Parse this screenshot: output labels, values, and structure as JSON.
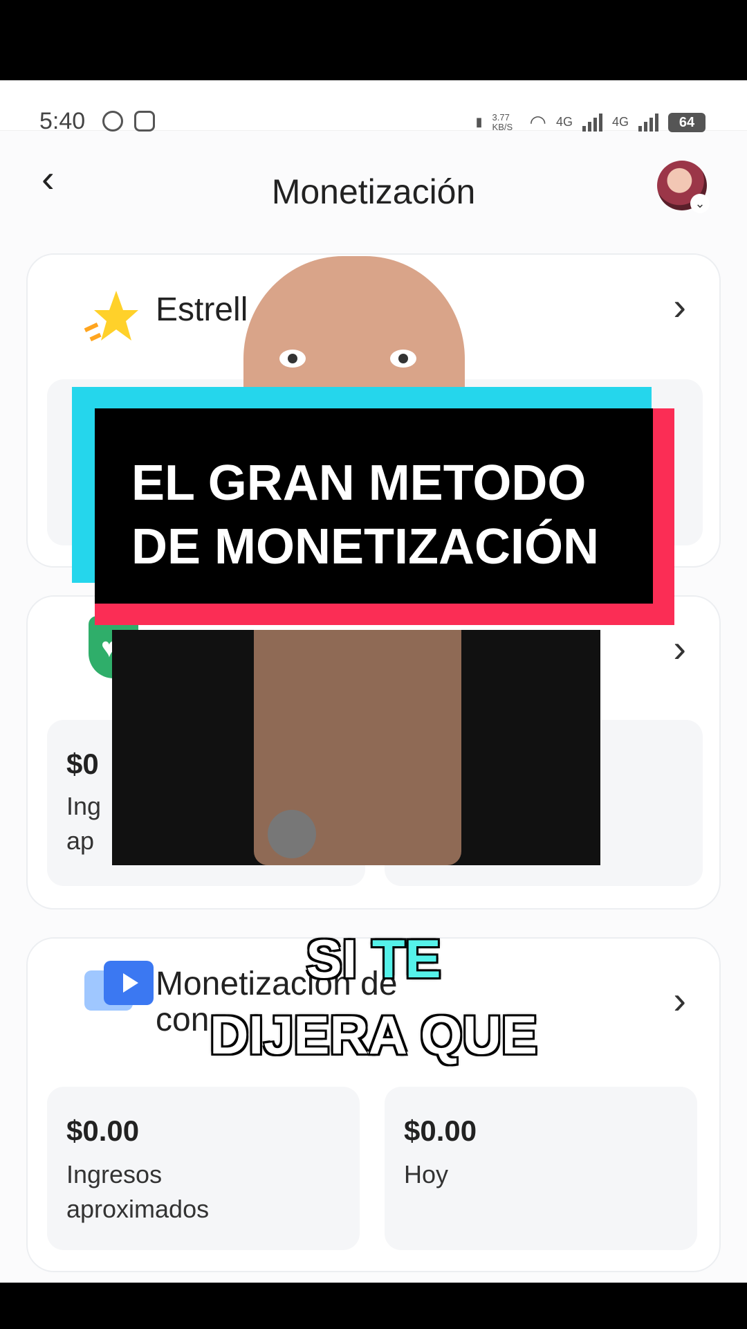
{
  "status_bar": {
    "time": "5:40",
    "net_speed": "3.77 KB/S",
    "battery": "64",
    "net1": "4G",
    "net2": "4G"
  },
  "header": {
    "title": "Monetización"
  },
  "cards": [
    {
      "title": "Estrell"
    },
    {
      "amount": "$0",
      "label_line1": "Ing",
      "label_line2": "ap"
    },
    {
      "title_line1": "Monetización de",
      "title_line2": "con",
      "amount1": "$0.00",
      "label1_line1": "Ingresos",
      "label1_line2": "aproximados",
      "amount2": "$0.00",
      "label2": "Hoy"
    }
  ],
  "overlay": {
    "banner_line1": "EL GRAN METODO",
    "banner_line2": "DE MONETIZACIÓN",
    "subtitle_word1": "SI",
    "subtitle_word2": "TE",
    "subtitle_line2": "DIJERA QUE"
  },
  "colors": {
    "banner_cyan": "#25d6ec",
    "banner_red": "#fb2d55",
    "subtitle_highlight": "#55f1e9"
  }
}
